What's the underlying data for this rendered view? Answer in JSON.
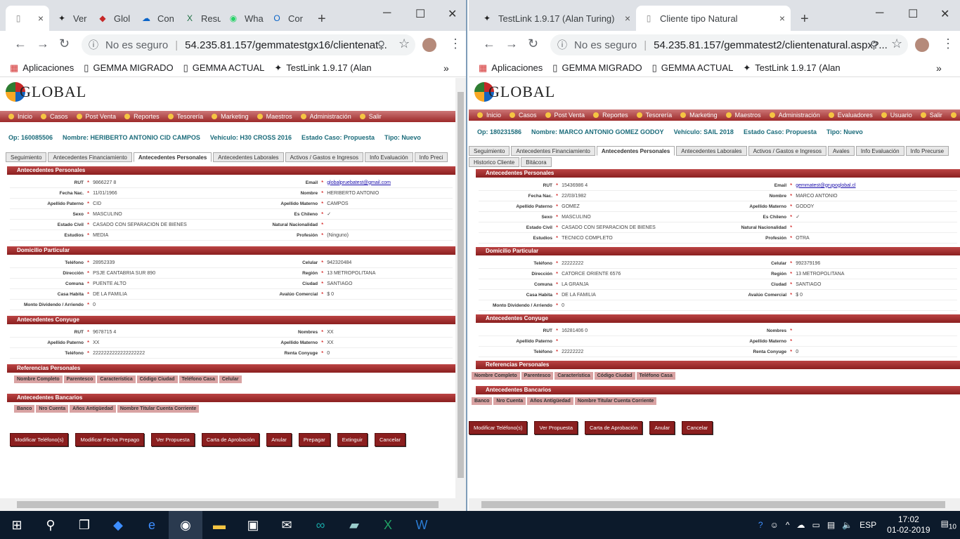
{
  "left": {
    "tabs": [
      {
        "label": "",
        "icon": "page-icon"
      },
      {
        "label": "Ver",
        "icon": "testlink-icon"
      },
      {
        "label": "Glol",
        "icon": "global-icon"
      },
      {
        "label": "Con",
        "icon": "onedrive-icon"
      },
      {
        "label": "Resu",
        "icon": "excel-icon"
      },
      {
        "label": "Wha",
        "icon": "whatsapp-icon"
      },
      {
        "label": "Cor",
        "icon": "outlook-icon"
      }
    ],
    "security": "No es seguro",
    "url": "54.235.81.157/gemmatestgx16/clientenat...",
    "bookmarks": [
      "Aplicaciones",
      "GEMMA MIGRADO",
      "GEMMA ACTUAL",
      "TestLink 1.9.17 (Alan"
    ],
    "menu": [
      "Inicio",
      "Casos",
      "Post Venta",
      "Reportes",
      "Tesorería",
      "Marketing",
      "Maestros",
      "Administración",
      "Salir"
    ],
    "info": {
      "op": "Op: 160085506",
      "nombre": "Nombre: HERIBERTO ANTONIO CID CAMPOS",
      "vehiculo": "Vehículo: H30 CROSS 2016",
      "estado": "Estado Caso: Propuesta",
      "tipo": "Tipo: Nuevo"
    },
    "subtabs": [
      "Seguimiento",
      "Antecedentes Financiamiento",
      "Antecedentes Personales",
      "Antecedentes Laborales",
      "Activos / Gastos e Ingresos",
      "Info Evaluación",
      "Info Preci"
    ],
    "sections": {
      "personales": "Antecedentes Personales",
      "domicilio": "Domicilio Particular",
      "conyuge": "Antecedentes Conyuge",
      "referencias": "Referencias Personales",
      "bancarios": "Antecedentes Bancarios"
    },
    "personales": [
      {
        "l1": "RUT",
        "v1": "9866227 8",
        "l2": "Email",
        "v2": "globalpruebatest@gmail.com"
      },
      {
        "l1": "Fecha Nac.",
        "v1": "11/01/1966",
        "l2": "Nombre",
        "v2": "HERIBERTO ANTONIO"
      },
      {
        "l1": "Apellido Paterno",
        "v1": "CID",
        "l2": "Apellido Materno",
        "v2": "CAMPOS"
      },
      {
        "l1": "Sexo",
        "v1": "MASCULINO",
        "l2": "Es Chileno",
        "v2": "✓"
      },
      {
        "l1": "Estado Civil",
        "v1": "CASADO CON SEPARACION DE BIENES",
        "l2": "Natural Nacionalidad",
        "v2": ""
      },
      {
        "l1": "Estudios",
        "v1": "MEDIA",
        "l2": "Profesión",
        "v2": "(Ninguno)"
      }
    ],
    "domicilio": [
      {
        "l1": "Teléfono",
        "v1": "28952339",
        "l2": "Celular",
        "v2": "942320484"
      },
      {
        "l1": "Dirección",
        "v1": "PSJE CANTABRIA SUR 890",
        "l2": "Región",
        "v2": "13 METROPOLITANA"
      },
      {
        "l1": "Comuna",
        "v1": "PUENTE ALTO",
        "l2": "Ciudad",
        "v2": "SANTIAGO"
      },
      {
        "l1": "Casa Habita",
        "v1": "DE LA FAMILIA",
        "l2": "Avalúo Comercial",
        "v2": "$ 0"
      },
      {
        "l1": "Monto Dividendo / Arriendo",
        "v1": "0",
        "l2": "",
        "v2": ""
      }
    ],
    "conyuge": [
      {
        "l1": "RUT",
        "v1": "9678715 4",
        "l2": "Nombres",
        "v2": "XX"
      },
      {
        "l1": "Apellido Paterno",
        "v1": "XX",
        "l2": "Apellido Materno",
        "v2": "XX"
      },
      {
        "l1": "Teléfono",
        "v1": "2222222222222222222",
        "l2": "Renta Conyuge",
        "v2": "0"
      }
    ],
    "ref_headers": [
      "Nombre Completo",
      "Parentesco",
      "Característica",
      "Código Ciudad",
      "Teléfono Casa",
      "Celular"
    ],
    "banco_headers": [
      "Banco",
      "Nro Cuenta",
      "Años Antigüedad",
      "Nombre Titular Cuenta Corriente"
    ],
    "buttons": [
      "Modificar Teléfono(s)",
      "Modificar Fecha Prepago",
      "Ver Propuesta",
      "Carta de Aprobación",
      "Anular",
      "Prepagar",
      "Extinguir",
      "Cancelar"
    ]
  },
  "right": {
    "tabs": [
      {
        "label": "TestLink 1.9.17 (Alan Turing)",
        "icon": "testlink-icon"
      },
      {
        "label": "Cliente tipo Natural",
        "icon": "page-icon"
      }
    ],
    "security": "No es seguro",
    "url": "54.235.81.157/gemmatest2/clientenatural.aspx?...",
    "bookmarks": [
      "Aplicaciones",
      "GEMMA MIGRADO",
      "GEMMA ACTUAL",
      "TestLink 1.9.17 (Alan"
    ],
    "menu": [
      "Inicio",
      "Casos",
      "Post Venta",
      "Reportes",
      "Tesorería",
      "Marketing",
      "Maestros",
      "Administración",
      "Evaluadores",
      "Usuario",
      "Salir",
      "Usu"
    ],
    "info": {
      "op": "Op: 180231586",
      "nombre": "Nombre: MARCO ANTONIO GOMEZ GODOY",
      "vehiculo": "Vehículo: SAIL 2018",
      "estado": "Estado Caso: Propuesta",
      "tipo": "Tipo: Nuevo"
    },
    "subtabs": [
      "Seguimiento",
      "Antecedentes Financiamiento",
      "Antecedentes Personales",
      "Antecedentes Laborales",
      "Activos / Gastos e Ingresos",
      "Avales",
      "Info Evaluación",
      "Info Precurse",
      "Historico Cliente",
      "Bitácora"
    ],
    "sections": {
      "personales": "Antecedentes Personales",
      "domicilio": "Domicilio Particular",
      "conyuge": "Antecedentes Conyuge",
      "referencias": "Referencias Personales",
      "bancarios": "Antecedentes Bancarios"
    },
    "personales": [
      {
        "l1": "RUT",
        "v1": "15436986 4",
        "l2": "Email",
        "v2": "gemmatest@grupoglobal.cl"
      },
      {
        "l1": "Fecha Nac.",
        "v1": "22/03/1982",
        "l2": "Nombre",
        "v2": "MARCO ANTONIO"
      },
      {
        "l1": "Apellido Paterno",
        "v1": "GOMEZ",
        "l2": "Apellido Materno",
        "v2": "GODOY"
      },
      {
        "l1": "Sexo",
        "v1": "MASCULINO",
        "l2": "Es Chileno",
        "v2": "✓"
      },
      {
        "l1": "Estado Civil",
        "v1": "CASADO CON SEPARACION DE BIENES",
        "l2": "Natural Nacionalidad",
        "v2": ""
      },
      {
        "l1": "Estudios",
        "v1": "TECNICO COMPLETO",
        "l2": "Profesión",
        "v2": "OTRA"
      }
    ],
    "domicilio": [
      {
        "l1": "Teléfono",
        "v1": "22222222",
        "l2": "Celular",
        "v2": "992379196"
      },
      {
        "l1": "Dirección",
        "v1": "CATORCE ORIENTE 6576",
        "l2": "Región",
        "v2": "13 METROPOLITANA"
      },
      {
        "l1": "Comuna",
        "v1": "LA GRANJA",
        "l2": "Ciudad",
        "v2": "SANTIAGO"
      },
      {
        "l1": "Casa Habita",
        "v1": "DE LA FAMILIA",
        "l2": "Avalúo Comercial",
        "v2": "$ 0"
      },
      {
        "l1": "Monto Dividendo / Arriendo",
        "v1": "0",
        "l2": "",
        "v2": ""
      }
    ],
    "conyuge": [
      {
        "l1": "RUT",
        "v1": "16281406 0",
        "l2": "Nombres",
        "v2": ""
      },
      {
        "l1": "Apellido Paterno",
        "v1": "",
        "l2": "Apellido Materno",
        "v2": ""
      },
      {
        "l1": "Teléfono",
        "v1": "22222222",
        "l2": "Renta Conyuge",
        "v2": "0"
      }
    ],
    "ref_headers": [
      "Nombre Completo",
      "Parentesco",
      "Característica",
      "Código Ciudad",
      "Teléfono Casa"
    ],
    "banco_headers": [
      "Banco",
      "Nro Cuenta",
      "Años Antigüedad",
      "Nombre Titular Cuenta Corriente"
    ],
    "buttons": [
      "Modificar Teléfono(s)",
      "Ver Propuesta",
      "Carta de Aprobación",
      "Anular",
      "Cancelar"
    ]
  },
  "taskbar": {
    "lang": "ESP",
    "time": "17:02",
    "date": "01-02-2019",
    "notif": "10"
  }
}
